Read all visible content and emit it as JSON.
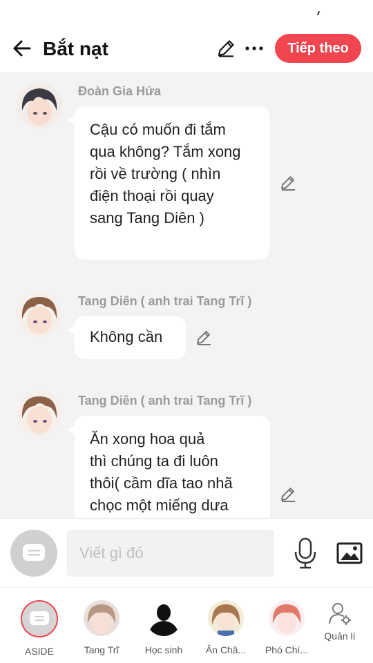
{
  "header": {
    "title": "Bắt nạt",
    "next_label": "Tiếp theo"
  },
  "messages": [
    {
      "sender": "Đoàn Gia Hứa",
      "lines": [
        "Cậu có muốn đi tắm",
        "qua không? Tắm xong",
        "rồi về trường ( nhìn",
        "điện thoại rồi quay",
        "sang Tang Diên )"
      ]
    },
    {
      "sender": "Tang Diên ( anh trai Tang Trĩ )",
      "lines": [
        "Không cần"
      ]
    },
    {
      "sender": "Tang Diên ( anh trai Tang Trĩ )",
      "lines": [
        "Ăn xong hoa quả",
        "thì chúng ta đi luôn",
        "thôi( cầm dĩa tao nhã",
        "chọc một miếng dưa"
      ]
    }
  ],
  "composer": {
    "placeholder": "Viết gì đó"
  },
  "characters": [
    {
      "label": "ASIDE"
    },
    {
      "label": "Tang Trĩ"
    },
    {
      "label": "Học sinh"
    },
    {
      "label": "Ân Châ..."
    },
    {
      "label": "Phó Chí..."
    }
  ],
  "manage_label": "Quản lí",
  "colors": {
    "accent": "#f1454f",
    "background": "#f3f3f3",
    "bubble": "#ffffff",
    "sender": "#9a9a9a"
  },
  "icons": [
    "back-arrow-icon",
    "pencil-icon",
    "more-dots-icon",
    "keyboard-icon",
    "microphone-icon",
    "image-icon",
    "manage-user-icon"
  ]
}
